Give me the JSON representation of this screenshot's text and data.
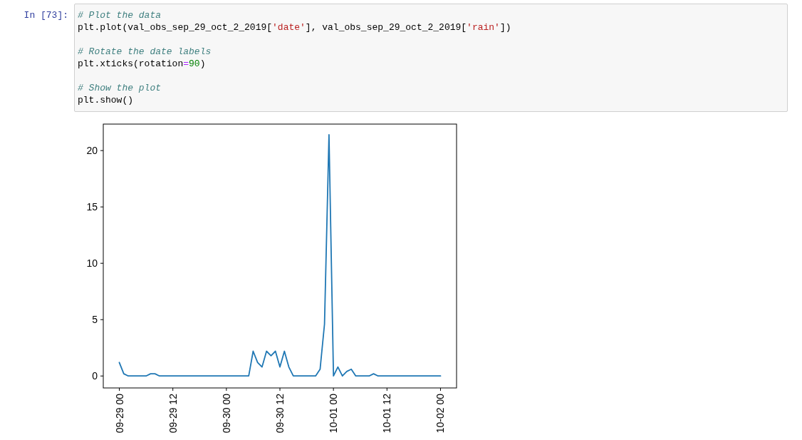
{
  "cell": {
    "prompt": "In [73]:",
    "blocks": [
      {
        "comment": "# Plot the data",
        "code": [
          {
            "kind": "plain",
            "text": "plt.plot(val_obs_sep_29_oct_2_2019["
          },
          {
            "kind": "string",
            "text": "'date'"
          },
          {
            "kind": "plain",
            "text": "], val_obs_sep_29_oct_2_2019["
          },
          {
            "kind": "string",
            "text": "'rain'"
          },
          {
            "kind": "plain",
            "text": "])"
          }
        ]
      },
      {
        "comment": "# Rotate the date labels",
        "code": [
          {
            "kind": "plain",
            "text": "plt.xticks(rotation"
          },
          {
            "kind": "operator",
            "text": "="
          },
          {
            "kind": "number",
            "text": "90"
          },
          {
            "kind": "plain",
            "text": ")"
          }
        ]
      },
      {
        "comment": "# Show the plot",
        "code": [
          {
            "kind": "plain",
            "text": "plt.show()"
          }
        ]
      }
    ]
  },
  "output": {
    "chart_data": {
      "type": "line",
      "ylim": [
        -1.06,
        22.35
      ],
      "yticks": [
        0,
        5,
        10,
        15,
        20
      ],
      "categories": [
        "09-29 00",
        null,
        null,
        null,
        null,
        null,
        null,
        null,
        null,
        null,
        null,
        null,
        "09-29 12",
        null,
        null,
        null,
        null,
        null,
        null,
        null,
        null,
        null,
        null,
        null,
        "09-30 00",
        null,
        null,
        null,
        null,
        null,
        null,
        null,
        null,
        null,
        null,
        null,
        "09-30 12",
        null,
        null,
        null,
        null,
        null,
        null,
        null,
        null,
        null,
        null,
        null,
        "10-01 00",
        null,
        null,
        null,
        null,
        null,
        null,
        null,
        null,
        null,
        null,
        null,
        "10-01 12",
        null,
        null,
        null,
        null,
        null,
        null,
        null,
        null,
        null,
        null,
        null,
        "10-02 00"
      ],
      "series": [
        {
          "color": "#1f77b4",
          "values": [
            1.2,
            0.2,
            0,
            0,
            0,
            0,
            0,
            0.2,
            0.2,
            0,
            0,
            0,
            0,
            0,
            0,
            0,
            0,
            0,
            0,
            0,
            0,
            0,
            0,
            0,
            0,
            0,
            0,
            0,
            0,
            0,
            2.2,
            1.2,
            0.8,
            2.2,
            1.8,
            2.2,
            0.8,
            2.2,
            0.8,
            0,
            0,
            0,
            0,
            0,
            0,
            0.6,
            4.6,
            21.4,
            0,
            0.8,
            0,
            0.4,
            0.6,
            0,
            0,
            0,
            0,
            0.2,
            0,
            0,
            0,
            0,
            0,
            0,
            0,
            0,
            0,
            0,
            0,
            0,
            0,
            0,
            0
          ]
        }
      ]
    }
  }
}
